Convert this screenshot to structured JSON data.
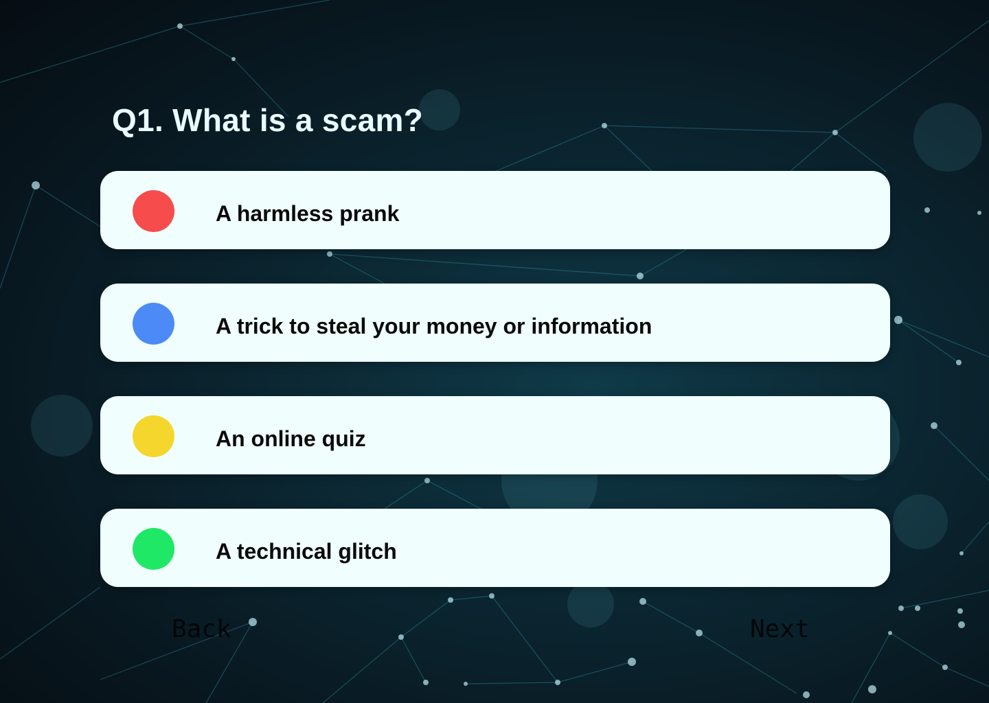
{
  "question": {
    "title": "Q1. What is a scam?"
  },
  "options": [
    {
      "label": "A harmless prank",
      "color": "#f64c4c"
    },
    {
      "label": "A trick to steal your money or information",
      "color": "#4c8af7"
    },
    {
      "label": "An online quiz",
      "color": "#f5d62c"
    },
    {
      "label": "A technical glitch",
      "color": "#1fe866"
    }
  ],
  "nav": {
    "back_label": "Back",
    "next_label": "Next"
  },
  "background": {
    "icon": "network-constellation-background"
  }
}
